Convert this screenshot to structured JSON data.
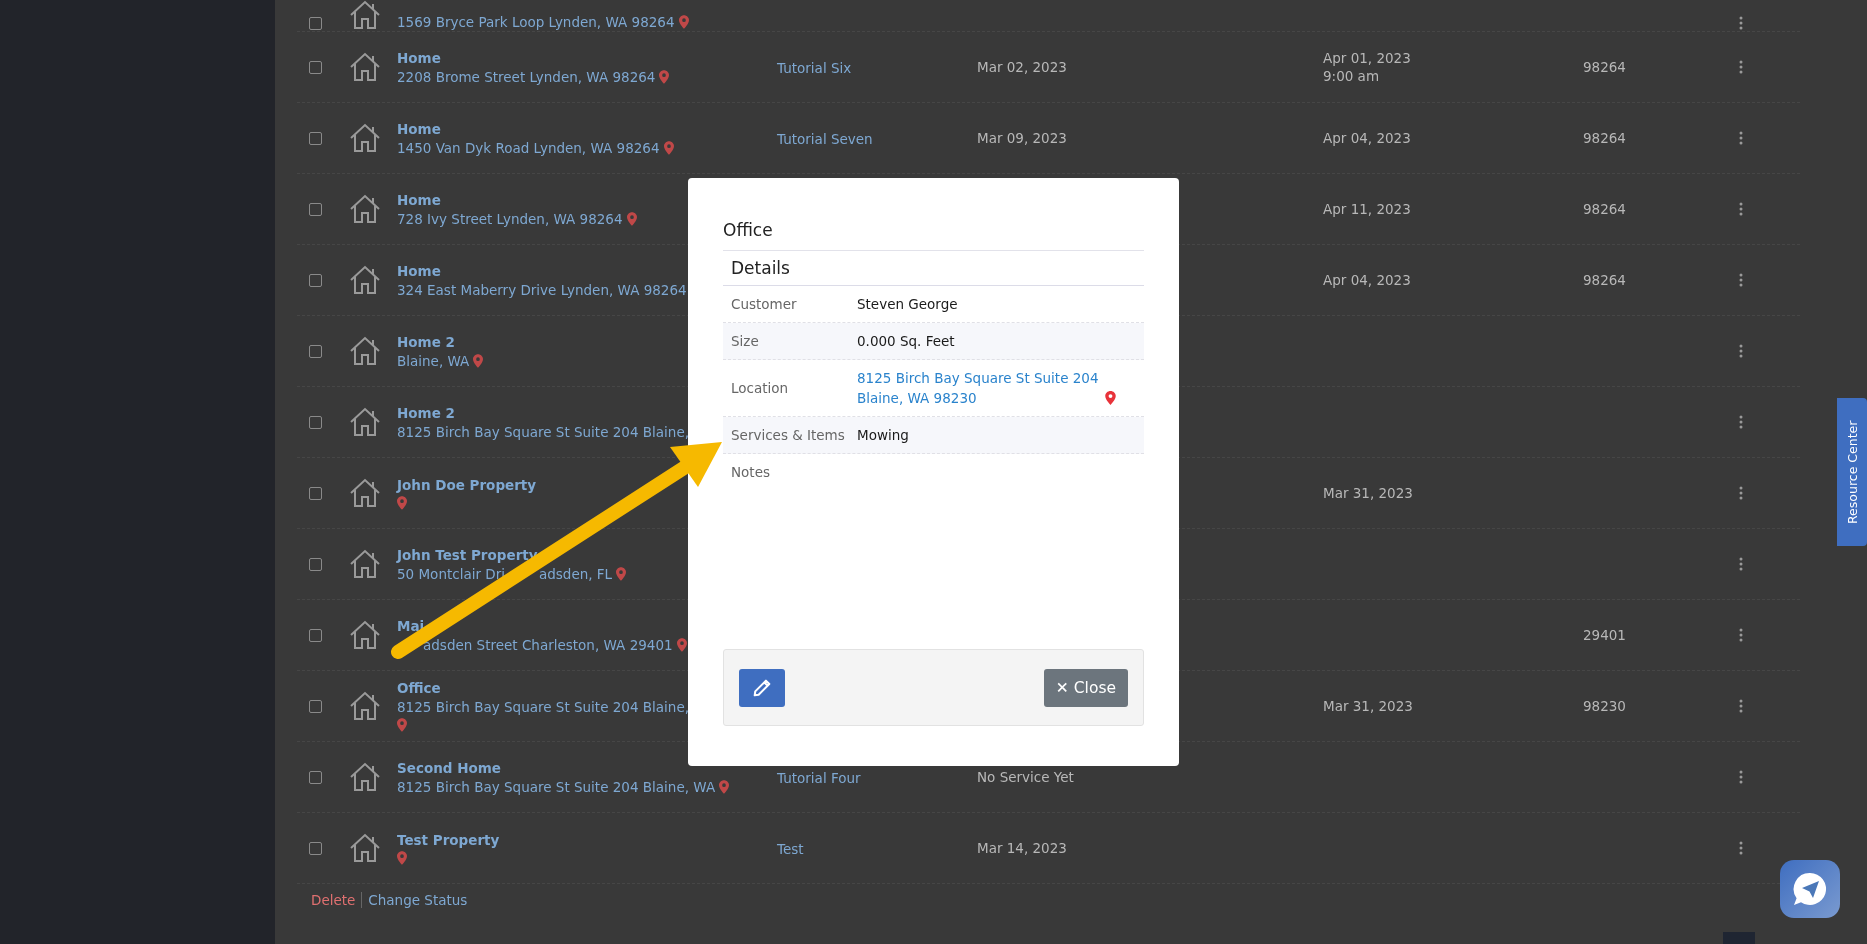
{
  "properties": [
    {
      "address": "1569 Bryce Park Loop Lynden, WA 98264",
      "pin_below": false,
      "checked": false
    },
    {
      "name": "Home",
      "address": "2208 Brome Street Lynden, WA 98264",
      "service": "Tutorial Six",
      "last_service": "Mar 02, 2023",
      "next_service": "Apr 01, 2023",
      "next_time": "9:00 am",
      "zip": "98264",
      "pin_below": false,
      "checked": false
    },
    {
      "name": "Home",
      "address": "1450 Van Dyk Road Lynden, WA 98264",
      "service": "Tutorial Seven",
      "last_service": "Mar 09, 2023",
      "next_service": "Apr 04, 2023",
      "zip": "98264",
      "pin_below": false,
      "checked": false
    },
    {
      "name": "Home",
      "address": "728 Ivy Street Lynden, WA 98264",
      "next_service": "Apr 11, 2023",
      "zip": "98264",
      "pin_below": false,
      "checked": false
    },
    {
      "name": "Home",
      "address": "324 East Maberry Drive Lynden, WA 98264",
      "next_service": "Apr 04, 2023",
      "zip": "98264",
      "pin_below": false,
      "checked": false
    },
    {
      "name": "Home 2",
      "address": "Blaine, WA",
      "pin_below": false,
      "checked": false
    },
    {
      "name": "Home 2",
      "address": "8125 Birch Bay Square St Suite 204 Blaine,",
      "pin_below": false,
      "checked": false
    },
    {
      "name": "John Doe Property",
      "next_service": "Mar 31, 2023",
      "pin_below": false,
      "checked": false
    },
    {
      "name": "John Test Property",
      "address": "50 Montclair Dri",
      "address_tail": "adsden, FL",
      "pin_below": false,
      "checked": false
    },
    {
      "name": "Mai",
      "address": "adsden Street Charleston, WA 29401",
      "covered_start": true,
      "zip": "29401",
      "pin_below": false,
      "checked": false
    },
    {
      "name": "Office",
      "address": "8125 Birch Bay Square St Suite 204 Blaine,",
      "pin_below": true,
      "next_service": "Mar 31, 2023",
      "zip": "98230",
      "checked": false
    },
    {
      "name": "Second Home",
      "address": "8125 Birch Bay Square St Suite 204 Blaine, WA",
      "service": "Tutorial Four",
      "last_service": "No Service Yet",
      "pin_below": false,
      "checked": false
    },
    {
      "name": "Test Property",
      "service": "Test",
      "last_service": "Mar 14, 2023",
      "pin_below": false,
      "checked": false
    }
  ],
  "actions": [
    {
      "label": "Delete",
      "kind": "danger"
    },
    {
      "label": "Change Status",
      "kind": "link"
    }
  ],
  "modal": {
    "title": "Office",
    "section": "Details",
    "fields": [
      {
        "label": "Customer",
        "kind": "text",
        "value": "Steven George"
      },
      {
        "label": "Size",
        "kind": "text",
        "value": "0.000 Sq. Feet"
      },
      {
        "label": "Location",
        "kind": "link",
        "lines": [
          "8125 Birch Bay Square St Suite 204",
          "Blaine, WA 98230"
        ]
      },
      {
        "label": "Services & Items",
        "kind": "text",
        "value": "Mowing"
      },
      {
        "label": "Notes",
        "kind": "notes"
      }
    ],
    "close_label": "✕ Close"
  },
  "resource_center": {
    "label": "Resource Center"
  }
}
